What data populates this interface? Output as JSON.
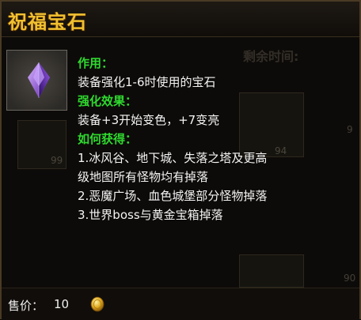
{
  "item": {
    "name": "祝福宝石",
    "icon": "purple-gem-icon",
    "sections": [
      {
        "heading": "作用：",
        "lines": [
          "装备强化1-6时使用的宝石"
        ]
      },
      {
        "heading": "强化效果：",
        "lines": [
          "装备+3开始变色，+7变亮"
        ]
      },
      {
        "heading": "如何获得：",
        "lines": [
          "1.冰风谷、地下城、失落之塔及更高",
          "级地图所有怪物均有掉落",
          "2.恶魔广场、血色城堡部分怪物掉落",
          "3.世界boss与黄金宝箱掉落"
        ]
      }
    ]
  },
  "price": {
    "label": "售价：",
    "value": "10",
    "currency_icon": "gold-coin-icon"
  },
  "background": {
    "remaining_time_label": "剩余时间:",
    "numbers": [
      "99",
      "94",
      "9",
      "90"
    ]
  },
  "colors": {
    "title": "#f0c030",
    "heading": "#2fd82f",
    "text": "#f4f4f4"
  }
}
